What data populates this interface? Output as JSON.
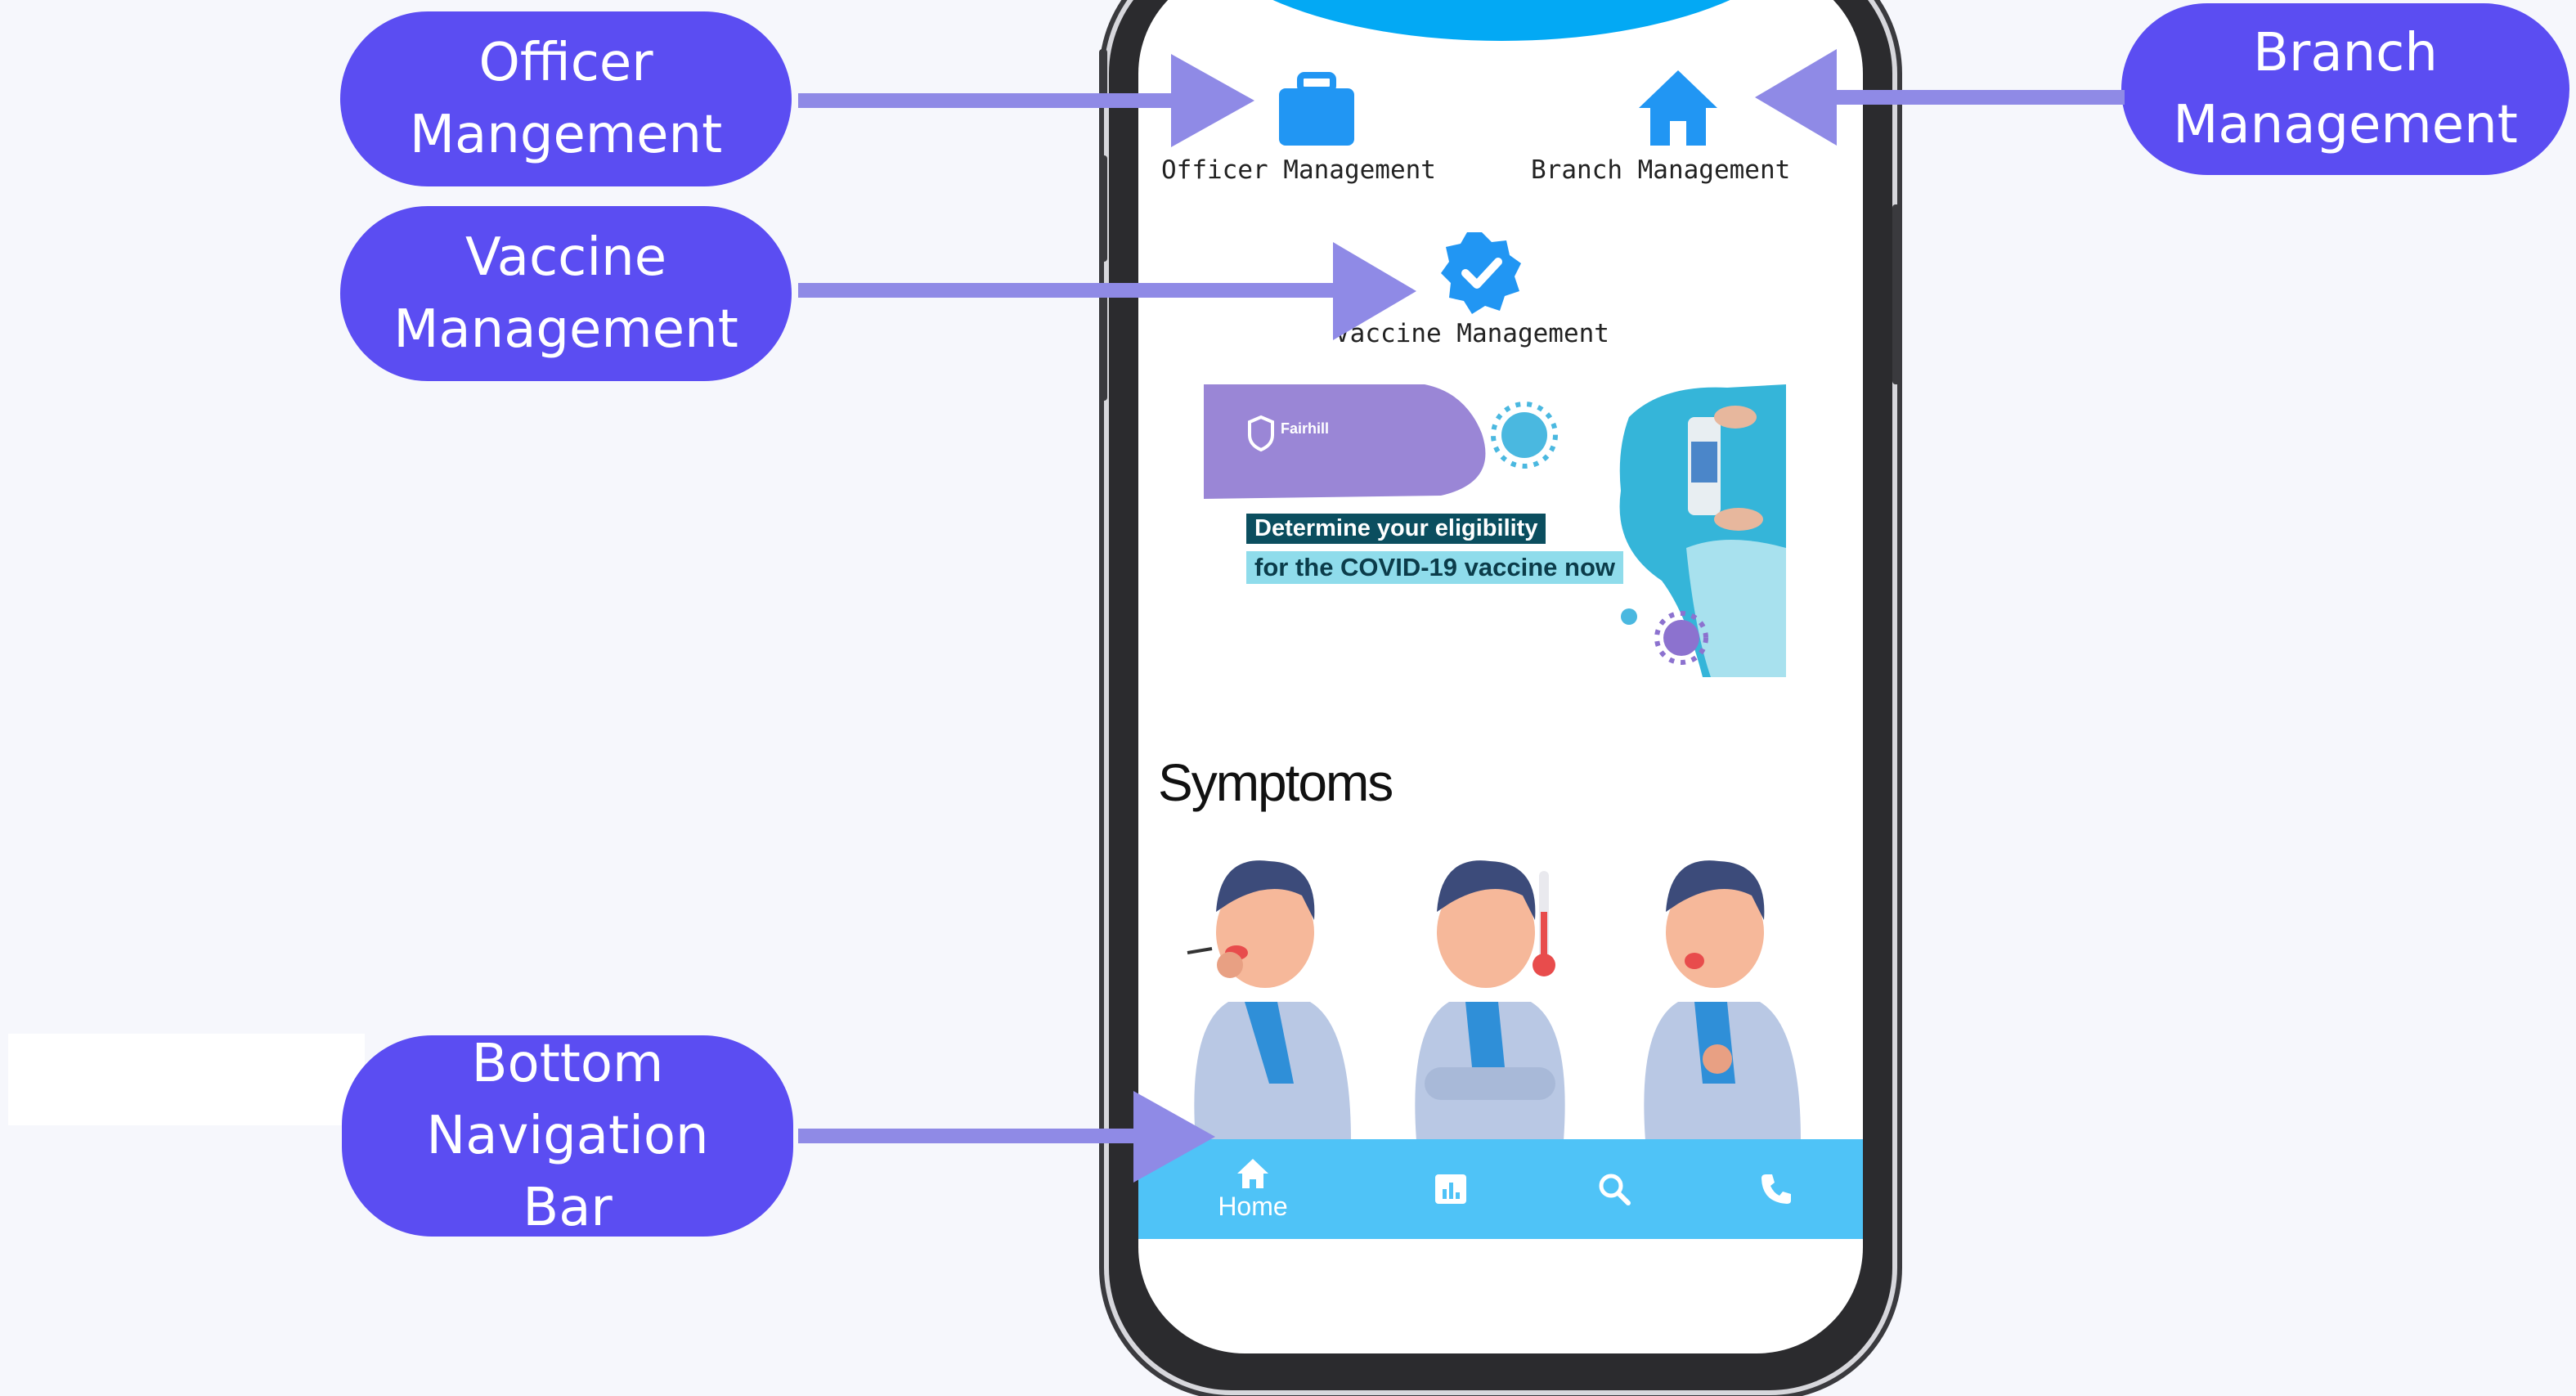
{
  "callouts": {
    "officer": [
      "Officer",
      "Mangement"
    ],
    "vaccine": [
      "Vaccine",
      "Management"
    ],
    "branch": [
      "Branch",
      "Management"
    ],
    "bottom_nav": [
      "Bottom",
      "Navigation",
      "Bar"
    ]
  },
  "menu": {
    "officer_label": "Officer Management",
    "branch_label": "Branch Management",
    "vaccine_label": "Vaccine Management"
  },
  "banner": {
    "brand": "Fairhill",
    "line1": "Determine your eligibility",
    "line2": "for the COVID-19 vaccine now"
  },
  "symptoms": {
    "title": "Symptoms"
  },
  "bottom_nav": {
    "items": [
      {
        "label": "Home",
        "icon": "home-icon"
      },
      {
        "label": "",
        "icon": "stats-icon"
      },
      {
        "label": "",
        "icon": "search-icon"
      },
      {
        "label": "",
        "icon": "phone-icon"
      }
    ]
  },
  "colors": {
    "callout_bg": "#5b4df2",
    "arrow": "#8f8ae6",
    "appbar": "#03a9f4",
    "navbar": "#4fc3f7",
    "icon_blue": "#2196f3"
  }
}
